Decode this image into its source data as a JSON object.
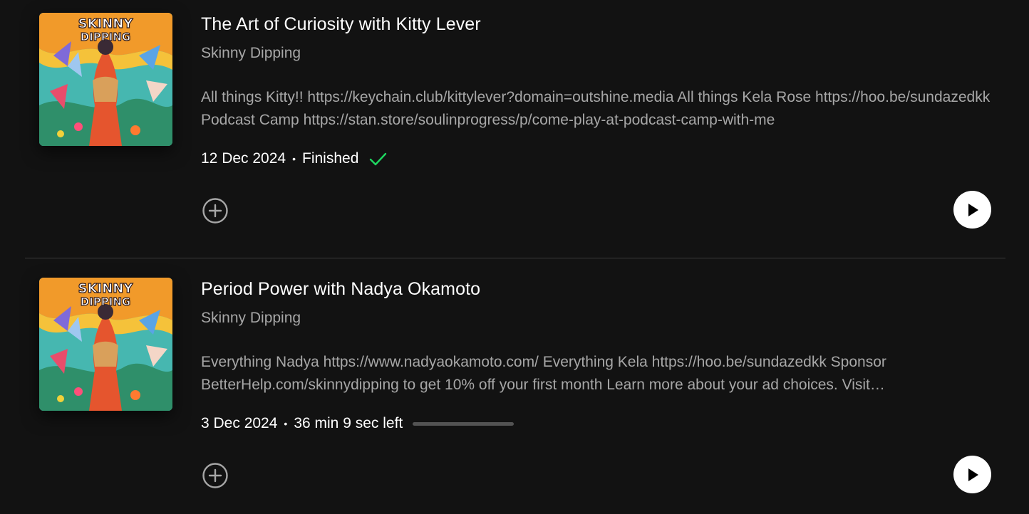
{
  "episodes": [
    {
      "title": "The Art of Curiosity with Kitty Lever",
      "show": "Skinny Dipping",
      "description": "All things Kitty!! https://keychain.club/kittylever?domain=outshine.media All things Kela Rose https://hoo.be/sundazedkk Podcast Camp https://stan.store/soulinprogress/p/come-play-at-podcast-camp-with-me",
      "date": "12 Dec 2024",
      "separator": "•",
      "status": "Finished",
      "status_icon": "check-icon",
      "status_color": "#1ed760",
      "cover_text": [
        "SKINNY",
        "DIPPING"
      ]
    },
    {
      "title": "Period Power with Nadya Okamoto",
      "show": "Skinny Dipping",
      "description": "Everything Nadya https://www.nadyaokamoto.com/ Everything Kela https://hoo.be/sundazedkk Sponsor BetterHelp.com/skinnydipping to get 10% off your first month Learn more about your ad choices. Visit megaphone.fm/adchoices",
      "date": "3 Dec 2024",
      "separator": "•",
      "status": "36 min 9 sec left",
      "progress": 0.0,
      "cover_text": [
        "SKINNY",
        "DIPPING"
      ]
    }
  ],
  "icons": {
    "add": "add-circle-icon",
    "play": "play-icon"
  },
  "colors": {
    "background": "#121212",
    "text_primary": "#ffffff",
    "text_secondary": "#a7a7a7",
    "accent_green": "#1ed760"
  }
}
